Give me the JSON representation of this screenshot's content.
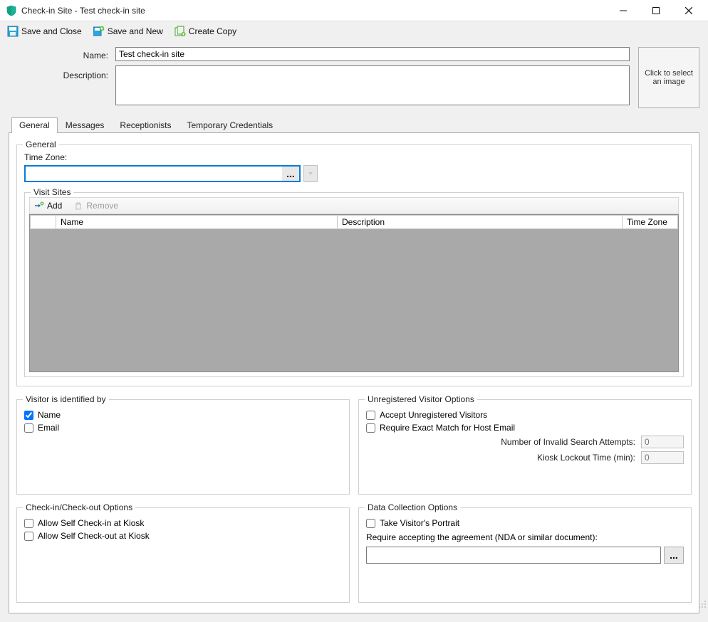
{
  "window": {
    "title": "Check-in Site  -  Test check-in site"
  },
  "toolbar": {
    "save_close": "Save and Close",
    "save_new": "Save and New",
    "create_copy": "Create Copy"
  },
  "form": {
    "name_label": "Name:",
    "name_value": "Test check-in site",
    "desc_label": "Description:",
    "desc_value": "",
    "image_box": "Click to select an image"
  },
  "tabs": {
    "general": "General",
    "messages": "Messages",
    "receptionists": "Receptionists",
    "temp_creds": "Temporary Credentials"
  },
  "general": {
    "legend": "General",
    "tz_label": "Time Zone:",
    "tz_value": ""
  },
  "visit_sites": {
    "legend": "Visit Sites",
    "add": "Add",
    "remove": "Remove",
    "col_name": "Name",
    "col_desc": "Description",
    "col_tz": "Time Zone"
  },
  "visitor_id": {
    "legend": "Visitor is identified by",
    "name": "Name",
    "email": "Email"
  },
  "unreg": {
    "legend": "Unregistered Visitor Options",
    "accept": "Accept Unregistered Visitors",
    "exact_match": "Require Exact Match for Host Email",
    "invalid_attempts_label": "Number of Invalid Search Attempts:",
    "invalid_attempts_value": "0",
    "lockout_label": "Kiosk Lockout Time (min):",
    "lockout_value": "0"
  },
  "checkin": {
    "legend": "Check-in/Check-out Options",
    "self_in": "Allow Self Check-in at Kiosk",
    "self_out": "Allow Self Check-out at Kiosk"
  },
  "data_collection": {
    "legend": "Data Collection Options",
    "portrait": "Take Visitor's Portrait",
    "agreement_label": "Require accepting the agreement (NDA or similar document):",
    "agreement_value": ""
  }
}
